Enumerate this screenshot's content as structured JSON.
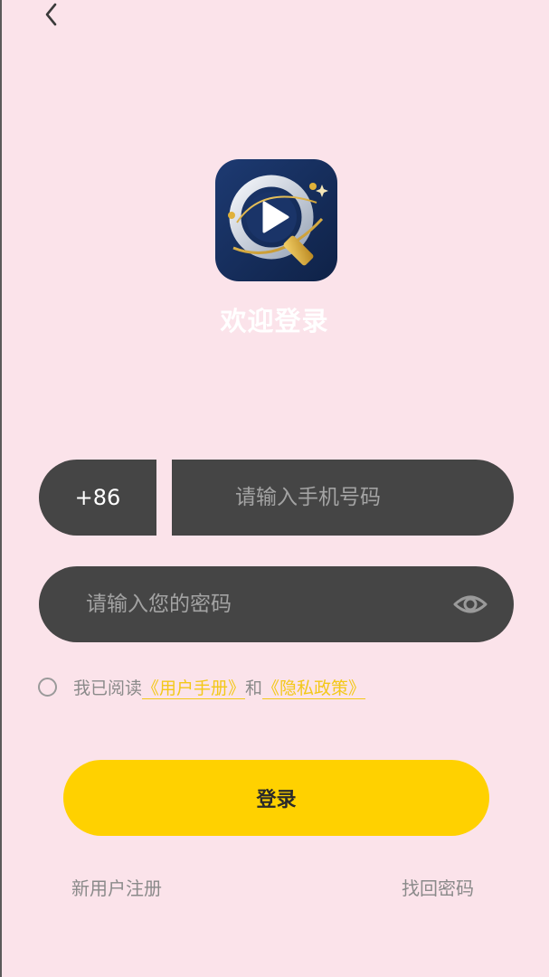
{
  "header": {
    "back_icon": "chevron-left-icon"
  },
  "logo": {
    "icon": "app-logo-play-icon",
    "colors": {
      "background": "#172f5e",
      "ring": "#dfe5ee",
      "accent": "#e0b13a"
    }
  },
  "welcome": {
    "title": "欢迎登录"
  },
  "form": {
    "country_code": "+86",
    "phone_placeholder": "请输入手机号码",
    "phone_value": "",
    "password_placeholder": "请输入您的密码",
    "password_value": "",
    "eye_icon": "eye-icon"
  },
  "agreement": {
    "checked": false,
    "prefix": "我已阅读",
    "user_manual": "《用户手册》",
    "and": "和",
    "privacy_policy": "《隐私政策》"
  },
  "actions": {
    "login_label": "登录",
    "register_label": "新用户注册",
    "forgot_label": "找回密码"
  },
  "colors": {
    "background": "#fbe3ea",
    "input_bg": "#454545",
    "accent": "#ffd100",
    "link": "#f3c818",
    "muted_text": "#8a8a8a"
  }
}
